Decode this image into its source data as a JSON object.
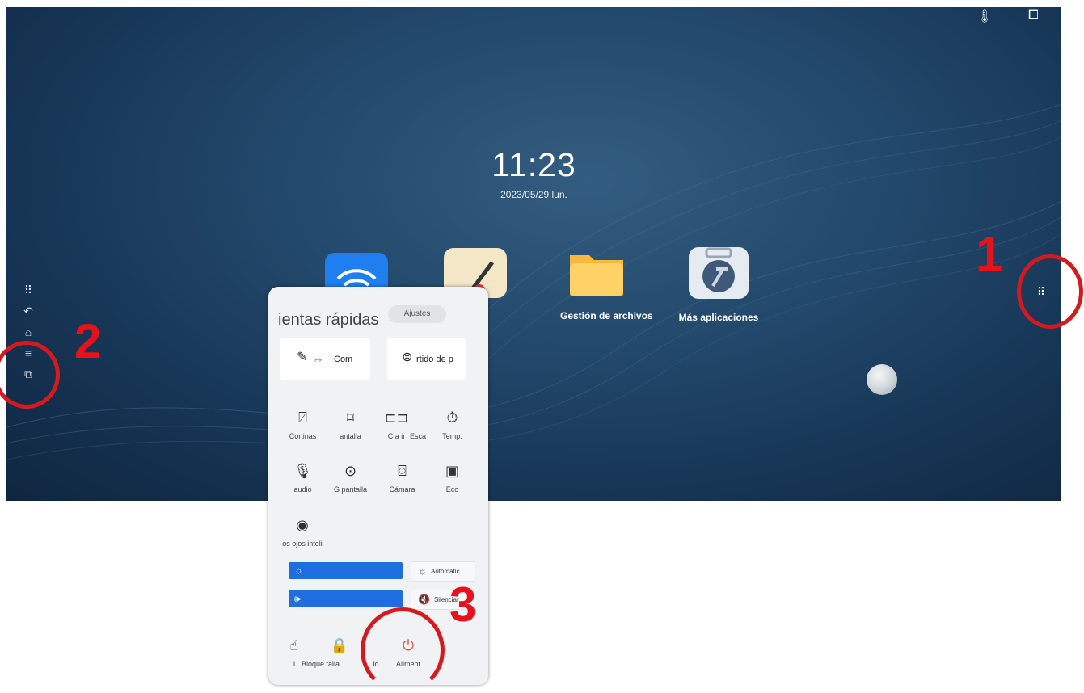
{
  "desktop": {
    "time": "11:23",
    "date": "2023/05/29 lun.",
    "top_icons": [
      "thermometer-icon",
      "screen-cast-icon"
    ],
    "apps": [
      {
        "label": "",
        "icon": "wifi-share-icon"
      },
      {
        "label": "",
        "icon": "whiteboard-pen-icon"
      },
      {
        "label": "Gestión de archivos",
        "icon": "folder-icon"
      },
      {
        "label": "Más aplicaciones",
        "icon": "toolbox-icon"
      }
    ]
  },
  "sidebar": {
    "items": [
      "apps-grid-icon",
      "back-icon",
      "home-icon",
      "menu-icon",
      "windows-icon"
    ]
  },
  "quick_panel": {
    "title": "ientas rápidas",
    "settings_label": "Ajustes",
    "cards": [
      {
        "label": "Com",
        "prefix": "↦",
        "icon": "annotate-icon"
      },
      {
        "label": "rtido de p",
        "icon": "screen-share-icon"
      }
    ],
    "tiles_row1": [
      {
        "label": "Cortinas",
        "icon": "curtain-icon"
      },
      {
        "label": "antalla",
        "icon": "screen-frame-icon"
      },
      {
        "label": "C  a ir",
        "icon": "capture-icon"
      },
      {
        "label": "Esca",
        "icon": "scan-icon"
      },
      {
        "label": "Temp.",
        "icon": "timer-icon"
      }
    ],
    "tiles_row2": [
      {
        "label": "audio",
        "icon": "microphone-icon"
      },
      {
        "label": "G  pantalla",
        "icon": "record-icon"
      },
      {
        "label": "Cámara",
        "icon": "camera-icon"
      },
      {
        "label": "Eco",
        "icon": "battery-icon"
      }
    ],
    "tiles_row3": [
      {
        "label": "os ojos inteli",
        "icon": "eye-care-icon"
      }
    ],
    "brightness": {
      "auto_label": "Automátic"
    },
    "volume": {
      "mute_label": "Silenciar"
    },
    "bottom": [
      {
        "label": "l",
        "icon": "touch-lock-icon"
      },
      {
        "label": "Bloque  talla",
        "icon": "lock-icon"
      },
      {
        "label": "lo",
        "icon": ""
      },
      {
        "label": "Aliment",
        "icon": "power-icon"
      }
    ]
  },
  "annotations": [
    {
      "number": "1",
      "color": "#e8101a"
    },
    {
      "number": "2",
      "color": "#e8101a"
    },
    {
      "number": "3",
      "color": "#e8101a"
    }
  ],
  "colors": {
    "accent": "#1e6ee0",
    "power": "#d9534f",
    "annotation": "#d41a1f"
  }
}
